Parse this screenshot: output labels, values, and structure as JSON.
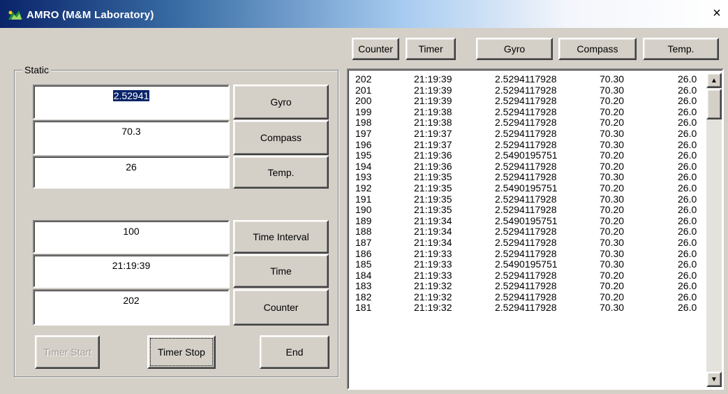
{
  "window": {
    "title": "AMRO (M&M Laboratory)",
    "close_glyph": "×"
  },
  "header_buttons": [
    "Counter",
    "Timer",
    "Gyro",
    "Compass",
    "Temp."
  ],
  "static_group": {
    "label": "Static",
    "gyro": {
      "value": "2.52941",
      "button": "Gyro"
    },
    "compass": {
      "value": "70.3",
      "button": "Compass"
    },
    "temp": {
      "value": "26",
      "button": "Temp."
    },
    "time_interval": {
      "value": "100",
      "button": "Time Interval"
    },
    "time": {
      "value": "21:19:39",
      "button": "Time"
    },
    "counter": {
      "value": "202",
      "button": "Counter"
    }
  },
  "controls": {
    "timer_start": "Timer Start",
    "timer_stop": "Timer Stop",
    "end": "End"
  },
  "log_rows": [
    [
      "202",
      "21:19:39",
      "2.5294117928",
      "70.30",
      "26.0"
    ],
    [
      "201",
      "21:19:39",
      "2.5294117928",
      "70.30",
      "26.0"
    ],
    [
      "200",
      "21:19:39",
      "2.5294117928",
      "70.20",
      "26.0"
    ],
    [
      "199",
      "21:19:38",
      "2.5294117928",
      "70.20",
      "26.0"
    ],
    [
      "198",
      "21:19:38",
      "2.5294117928",
      "70.20",
      "26.0"
    ],
    [
      "197",
      "21:19:37",
      "2.5294117928",
      "70.30",
      "26.0"
    ],
    [
      "196",
      "21:19:37",
      "2.5294117928",
      "70.30",
      "26.0"
    ],
    [
      "195",
      "21:19:36",
      "2.5490195751",
      "70.20",
      "26.0"
    ],
    [
      "194",
      "21:19:36",
      "2.5294117928",
      "70.20",
      "26.0"
    ],
    [
      "193",
      "21:19:35",
      "2.5294117928",
      "70.30",
      "26.0"
    ],
    [
      "192",
      "21:19:35",
      "2.5490195751",
      "70.20",
      "26.0"
    ],
    [
      "191",
      "21:19:35",
      "2.5294117928",
      "70.30",
      "26.0"
    ],
    [
      "190",
      "21:19:35",
      "2.5294117928",
      "70.20",
      "26.0"
    ],
    [
      "189",
      "21:19:34",
      "2.5490195751",
      "70.20",
      "26.0"
    ],
    [
      "188",
      "21:19:34",
      "2.5294117928",
      "70.20",
      "26.0"
    ],
    [
      "187",
      "21:19:34",
      "2.5294117928",
      "70.30",
      "26.0"
    ],
    [
      "186",
      "21:19:33",
      "2.5294117928",
      "70.30",
      "26.0"
    ],
    [
      "185",
      "21:19:33",
      "2.5490195751",
      "70.30",
      "26.0"
    ],
    [
      "184",
      "21:19:33",
      "2.5294117928",
      "70.20",
      "26.0"
    ],
    [
      "183",
      "21:19:32",
      "2.5294117928",
      "70.20",
      "26.0"
    ],
    [
      "182",
      "21:19:32",
      "2.5294117928",
      "70.20",
      "26.0"
    ],
    [
      "181",
      "21:19:32",
      "2.5294117928",
      "70.30",
      "26.0"
    ]
  ],
  "scrollbar": {
    "up_glyph": "▲",
    "down_glyph": "▼"
  }
}
